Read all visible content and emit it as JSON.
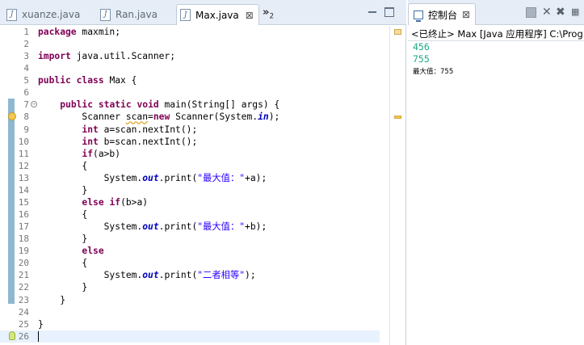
{
  "editor": {
    "tabs": [
      {
        "label": "xuanze.java",
        "active": false
      },
      {
        "label": "Ran.java",
        "active": false
      },
      {
        "label": "Max.java",
        "active": true
      }
    ],
    "close_glyph": "⊠",
    "overflow_glyph": "»",
    "overflow_count": "2",
    "code_lines": [
      {
        "n": "1",
        "parts": [
          {
            "t": "package",
            "c": "kw"
          },
          {
            "t": " maxmin;"
          }
        ]
      },
      {
        "n": "2",
        "parts": []
      },
      {
        "n": "3",
        "parts": [
          {
            "t": "import",
            "c": "kw"
          },
          {
            "t": " java.util.Scanner;"
          }
        ]
      },
      {
        "n": "4",
        "parts": []
      },
      {
        "n": "5",
        "parts": [
          {
            "t": "public",
            "c": "kw"
          },
          {
            "t": " "
          },
          {
            "t": "class",
            "c": "kw"
          },
          {
            "t": " Max {"
          }
        ]
      },
      {
        "n": "6",
        "parts": []
      },
      {
        "n": "7",
        "fold": true,
        "parts": [
          {
            "t": "    "
          },
          {
            "t": "public",
            "c": "kw"
          },
          {
            "t": " "
          },
          {
            "t": "static",
            "c": "kw"
          },
          {
            "t": " "
          },
          {
            "t": "void",
            "c": "kw"
          },
          {
            "t": " main(String[] args) {"
          }
        ]
      },
      {
        "n": "8",
        "warn": true,
        "parts": [
          {
            "t": "        Scanner "
          },
          {
            "t": "scan",
            "c": "ul"
          },
          {
            "t": "="
          },
          {
            "t": "new",
            "c": "kw"
          },
          {
            "t": " Scanner(System."
          },
          {
            "t": "in",
            "c": "sf"
          },
          {
            "t": ");"
          }
        ]
      },
      {
        "n": "9",
        "parts": [
          {
            "t": "        "
          },
          {
            "t": "int",
            "c": "kw"
          },
          {
            "t": " a=scan.nextInt();"
          }
        ]
      },
      {
        "n": "10",
        "parts": [
          {
            "t": "        "
          },
          {
            "t": "int",
            "c": "kw"
          },
          {
            "t": " b=scan.nextInt();"
          }
        ]
      },
      {
        "n": "11",
        "parts": [
          {
            "t": "        "
          },
          {
            "t": "if",
            "c": "kw"
          },
          {
            "t": "(a>b)"
          }
        ]
      },
      {
        "n": "12",
        "parts": [
          {
            "t": "        {"
          }
        ]
      },
      {
        "n": "13",
        "parts": [
          {
            "t": "            System."
          },
          {
            "t": "out",
            "c": "sf"
          },
          {
            "t": ".print("
          },
          {
            "t": "\"最大值：\"",
            "c": "st"
          },
          {
            "t": "+a);"
          }
        ]
      },
      {
        "n": "14",
        "parts": [
          {
            "t": "        }"
          }
        ]
      },
      {
        "n": "15",
        "parts": [
          {
            "t": "        "
          },
          {
            "t": "else",
            "c": "kw"
          },
          {
            "t": " "
          },
          {
            "t": "if",
            "c": "kw"
          },
          {
            "t": "(b>a)"
          }
        ]
      },
      {
        "n": "16",
        "parts": [
          {
            "t": "        {"
          }
        ]
      },
      {
        "n": "17",
        "parts": [
          {
            "t": "            System."
          },
          {
            "t": "out",
            "c": "sf"
          },
          {
            "t": ".print("
          },
          {
            "t": "\"最大值：\"",
            "c": "st"
          },
          {
            "t": "+b);"
          }
        ]
      },
      {
        "n": "18",
        "parts": [
          {
            "t": "        }"
          }
        ]
      },
      {
        "n": "19",
        "parts": [
          {
            "t": "        "
          },
          {
            "t": "else",
            "c": "kw"
          }
        ]
      },
      {
        "n": "20",
        "parts": [
          {
            "t": "        {"
          }
        ]
      },
      {
        "n": "21",
        "parts": [
          {
            "t": "            System."
          },
          {
            "t": "out",
            "c": "sf"
          },
          {
            "t": ".print("
          },
          {
            "t": "\"二者相等\"",
            "c": "st"
          },
          {
            "t": ");"
          }
        ]
      },
      {
        "n": "22",
        "parts": [
          {
            "t": "        }"
          }
        ]
      },
      {
        "n": "23",
        "parts": [
          {
            "t": "    }"
          }
        ]
      },
      {
        "n": "24",
        "parts": []
      },
      {
        "n": "25",
        "parts": [
          {
            "t": "}"
          }
        ]
      },
      {
        "n": "26",
        "bulb": true,
        "current": true,
        "parts": []
      }
    ]
  },
  "console": {
    "tab_label": "控制台",
    "close_glyph": "⊠",
    "header": "<已终止> Max [Java 应用程序] C:\\Prog",
    "input_lines": [
      "456",
      "755"
    ],
    "result_line": "最大值：755"
  }
}
